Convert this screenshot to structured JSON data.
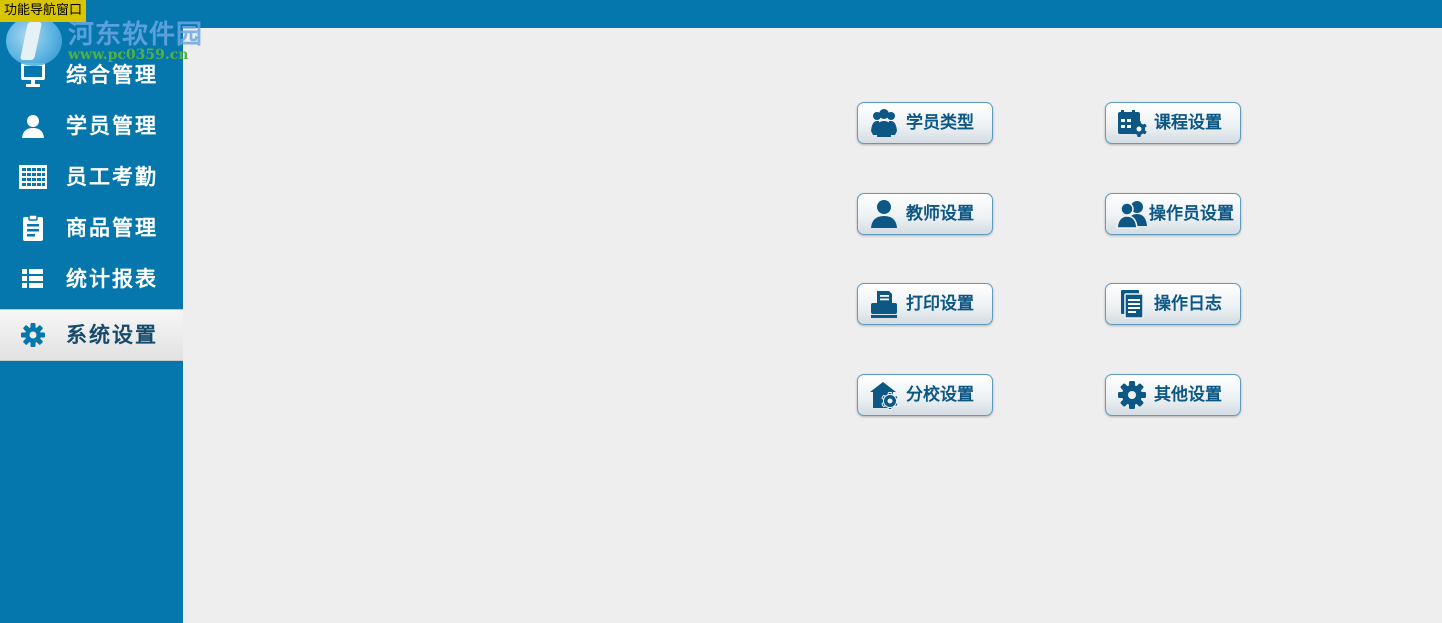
{
  "window": {
    "title": "功能导航窗口"
  },
  "watermark": {
    "text": "河东软件园",
    "url": "www.pc0359.cn"
  },
  "colors": {
    "brand": "#0577ad",
    "background": "#eeeeee",
    "button_text": "#0c5784",
    "active_nav": "#e8e8e8"
  },
  "sidebar": {
    "items": [
      {
        "label": "综合管理",
        "icon": "monitor-icon"
      },
      {
        "label": "学员管理",
        "icon": "person-icon"
      },
      {
        "label": "员工考勤",
        "icon": "grid-calendar-icon"
      },
      {
        "label": "商品管理",
        "icon": "clipboard-icon"
      },
      {
        "label": "统计报表",
        "icon": "list-icon"
      },
      {
        "label": "系统设置",
        "icon": "gear-icon",
        "active": true
      }
    ]
  },
  "main": {
    "buttons": [
      {
        "label": "学员类型",
        "icon": "students-group-icon"
      },
      {
        "label": "课程设置",
        "icon": "calendar-gear-icon"
      },
      {
        "label": "教师设置",
        "icon": "teacher-icon"
      },
      {
        "label": "操作员设置",
        "icon": "operators-icon"
      },
      {
        "label": "打印设置",
        "icon": "printer-icon"
      },
      {
        "label": "操作日志",
        "icon": "log-document-icon"
      },
      {
        "label": "分校设置",
        "icon": "branch-house-gear-icon"
      },
      {
        "label": "其他设置",
        "icon": "gear-icon"
      }
    ]
  }
}
